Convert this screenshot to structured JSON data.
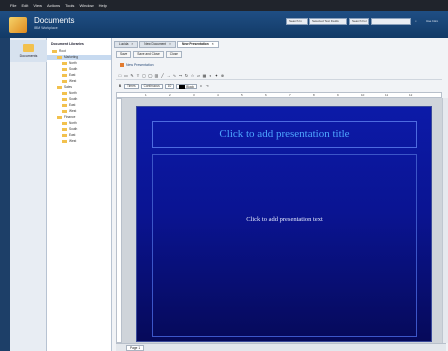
{
  "menubar": {
    "items": [
      "File",
      "Edit",
      "View",
      "Actions",
      "Tools",
      "Window",
      "Help"
    ]
  },
  "header": {
    "title": "Documents",
    "subtitle": "IBM Workplace",
    "search_placeholder": "Search In",
    "search_scope": "Selected Text Fields",
    "search_for": "Search For",
    "links": [
      "Use Intro"
    ]
  },
  "leftnav": {
    "label": "Documents"
  },
  "tree": {
    "heading": "Document Libraries",
    "rows": [
      {
        "label": "Root",
        "indent": 1
      },
      {
        "label": "Marketing",
        "indent": 2,
        "selected": true
      },
      {
        "label": "North",
        "indent": 3
      },
      {
        "label": "South",
        "indent": 3
      },
      {
        "label": "East",
        "indent": 3
      },
      {
        "label": "West",
        "indent": 3
      },
      {
        "label": "Sales",
        "indent": 2
      },
      {
        "label": "North",
        "indent": 3
      },
      {
        "label": "South",
        "indent": 3
      },
      {
        "label": "East",
        "indent": 3
      },
      {
        "label": "West",
        "indent": 3
      },
      {
        "label": "Finance",
        "indent": 2
      },
      {
        "label": "North",
        "indent": 3
      },
      {
        "label": "South",
        "indent": 3
      },
      {
        "label": "East",
        "indent": 3
      },
      {
        "label": "West",
        "indent": 3
      }
    ]
  },
  "tabs": [
    {
      "label": "Lucida"
    },
    {
      "label": "New Document"
    },
    {
      "label": "New Presentation",
      "active": true
    }
  ],
  "actions": [
    "Save",
    "Save and Close",
    "Close"
  ],
  "doc_name": "New Presentation",
  "toolbar": {
    "font_name": "Times",
    "font_size": "Continuous",
    "size_value": "10",
    "color_label": "Black"
  },
  "ruler_numbers": [
    "1",
    "2",
    "3",
    "4",
    "5",
    "6",
    "7",
    "8",
    "9",
    "10",
    "11",
    "12"
  ],
  "slide": {
    "title_placeholder": "Click to add presentation title",
    "body_placeholder": "Click to add presentation text"
  },
  "status": {
    "page": "Page 1"
  }
}
